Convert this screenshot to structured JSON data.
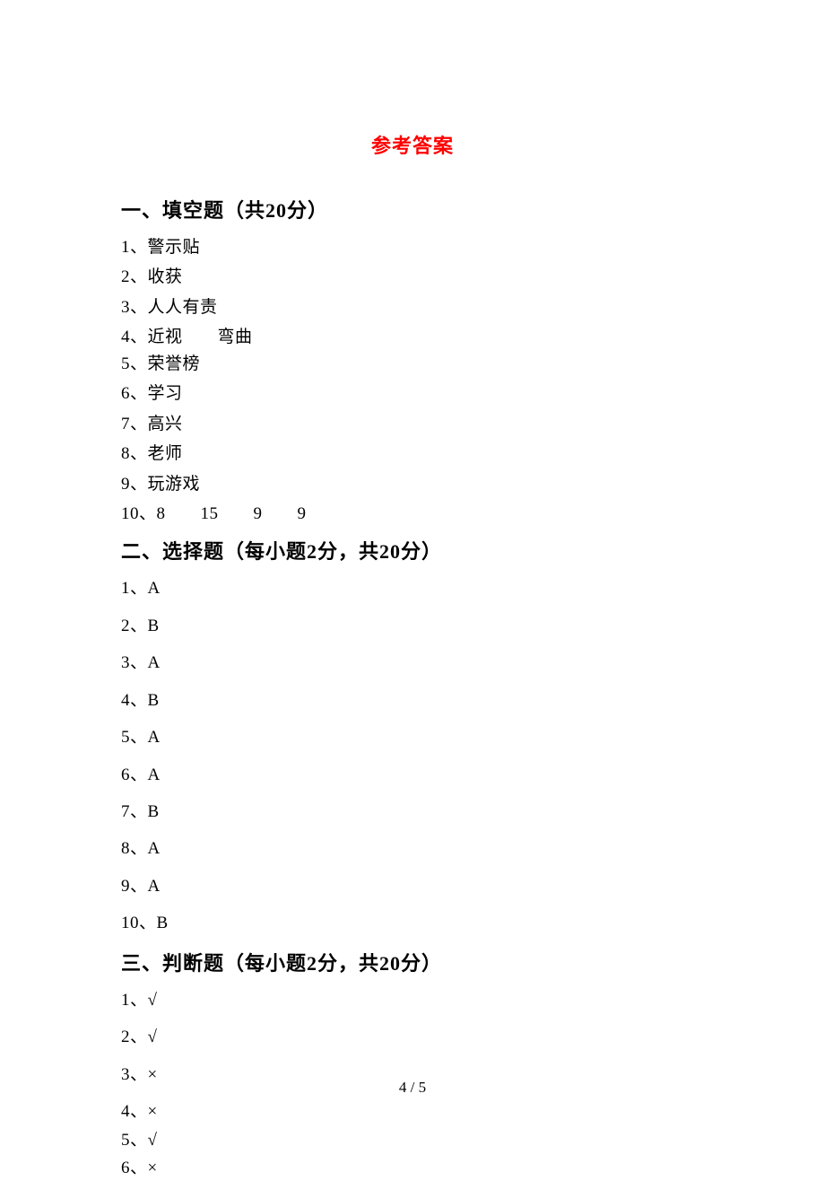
{
  "title": "参考答案",
  "sections": {
    "s1": {
      "heading": "一、填空题（共20分）",
      "items": [
        "1、警示贴",
        "2、收获",
        "3、人人有责",
        "4、近视　　弯曲",
        "5、荣誉榜",
        "6、学习",
        "7、高兴",
        "8、老师",
        "9、玩游戏",
        "10、8　　15　　9　　9"
      ]
    },
    "s2": {
      "heading": "二、选择题（每小题2分，共20分）",
      "items": [
        "1、A",
        "2、B",
        "3、A",
        "4、B",
        "5、A",
        "6、A",
        "7、B",
        "8、A",
        "9、A",
        "10、B"
      ]
    },
    "s3": {
      "heading": "三、判断题（每小题2分，共20分）",
      "items": [
        "1、√",
        "2、√",
        "3、×",
        "4、×",
        "5、√",
        "6、×"
      ]
    }
  },
  "pageNumber": "4 / 5"
}
